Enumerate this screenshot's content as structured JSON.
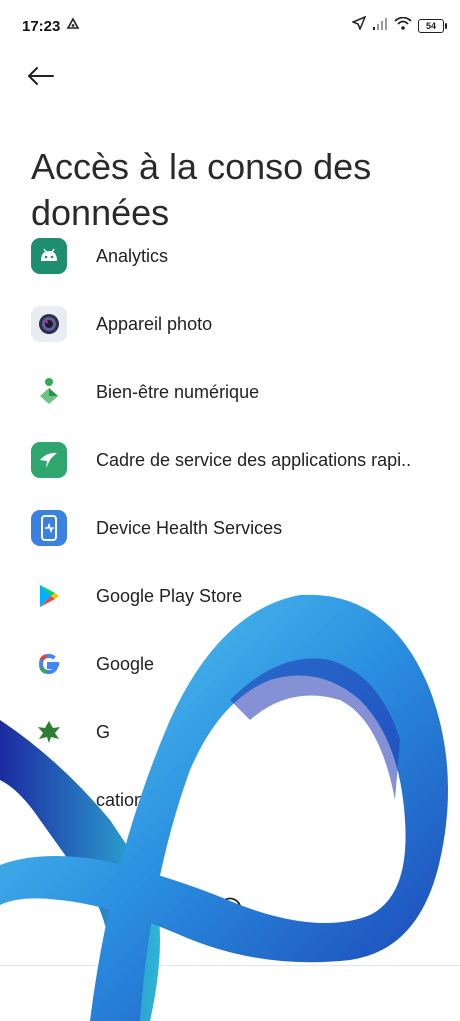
{
  "status_bar": {
    "time": "17:23",
    "battery": "54"
  },
  "header": {
    "title": "Accès à la conso des données"
  },
  "apps": [
    {
      "label": "Analytics",
      "icon": "android-icon",
      "color": "#1e8e6e"
    },
    {
      "label": "Appareil photo",
      "icon": "camera-icon",
      "color": "#e9edf3"
    },
    {
      "label": "Bien-être numérique",
      "icon": "digital-wellbeing-icon",
      "color": "#ffffff"
    },
    {
      "label": "Cadre de service des applications rapi..",
      "icon": "hummingbird-icon",
      "color": "#2fa56f"
    },
    {
      "label": "Device Health Services",
      "icon": "device-health-icon",
      "color": "#3b82e0"
    },
    {
      "label": "Google Play Store",
      "icon": "play-store-icon",
      "color": "#ffffff"
    },
    {
      "label": "Google",
      "icon": "google-icon",
      "color": "#ffffff"
    },
    {
      "label": "G",
      "icon": "leaf-icon",
      "color": "#ffffff"
    },
    {
      "label": "cations",
      "icon": "app-icon",
      "color": "#ffffff"
    },
    {
      "label": "",
      "icon": "transfer-icon",
      "color": "#ffffff"
    }
  ],
  "colors": {
    "accent": "#2aa6e0",
    "text": "#222222"
  }
}
